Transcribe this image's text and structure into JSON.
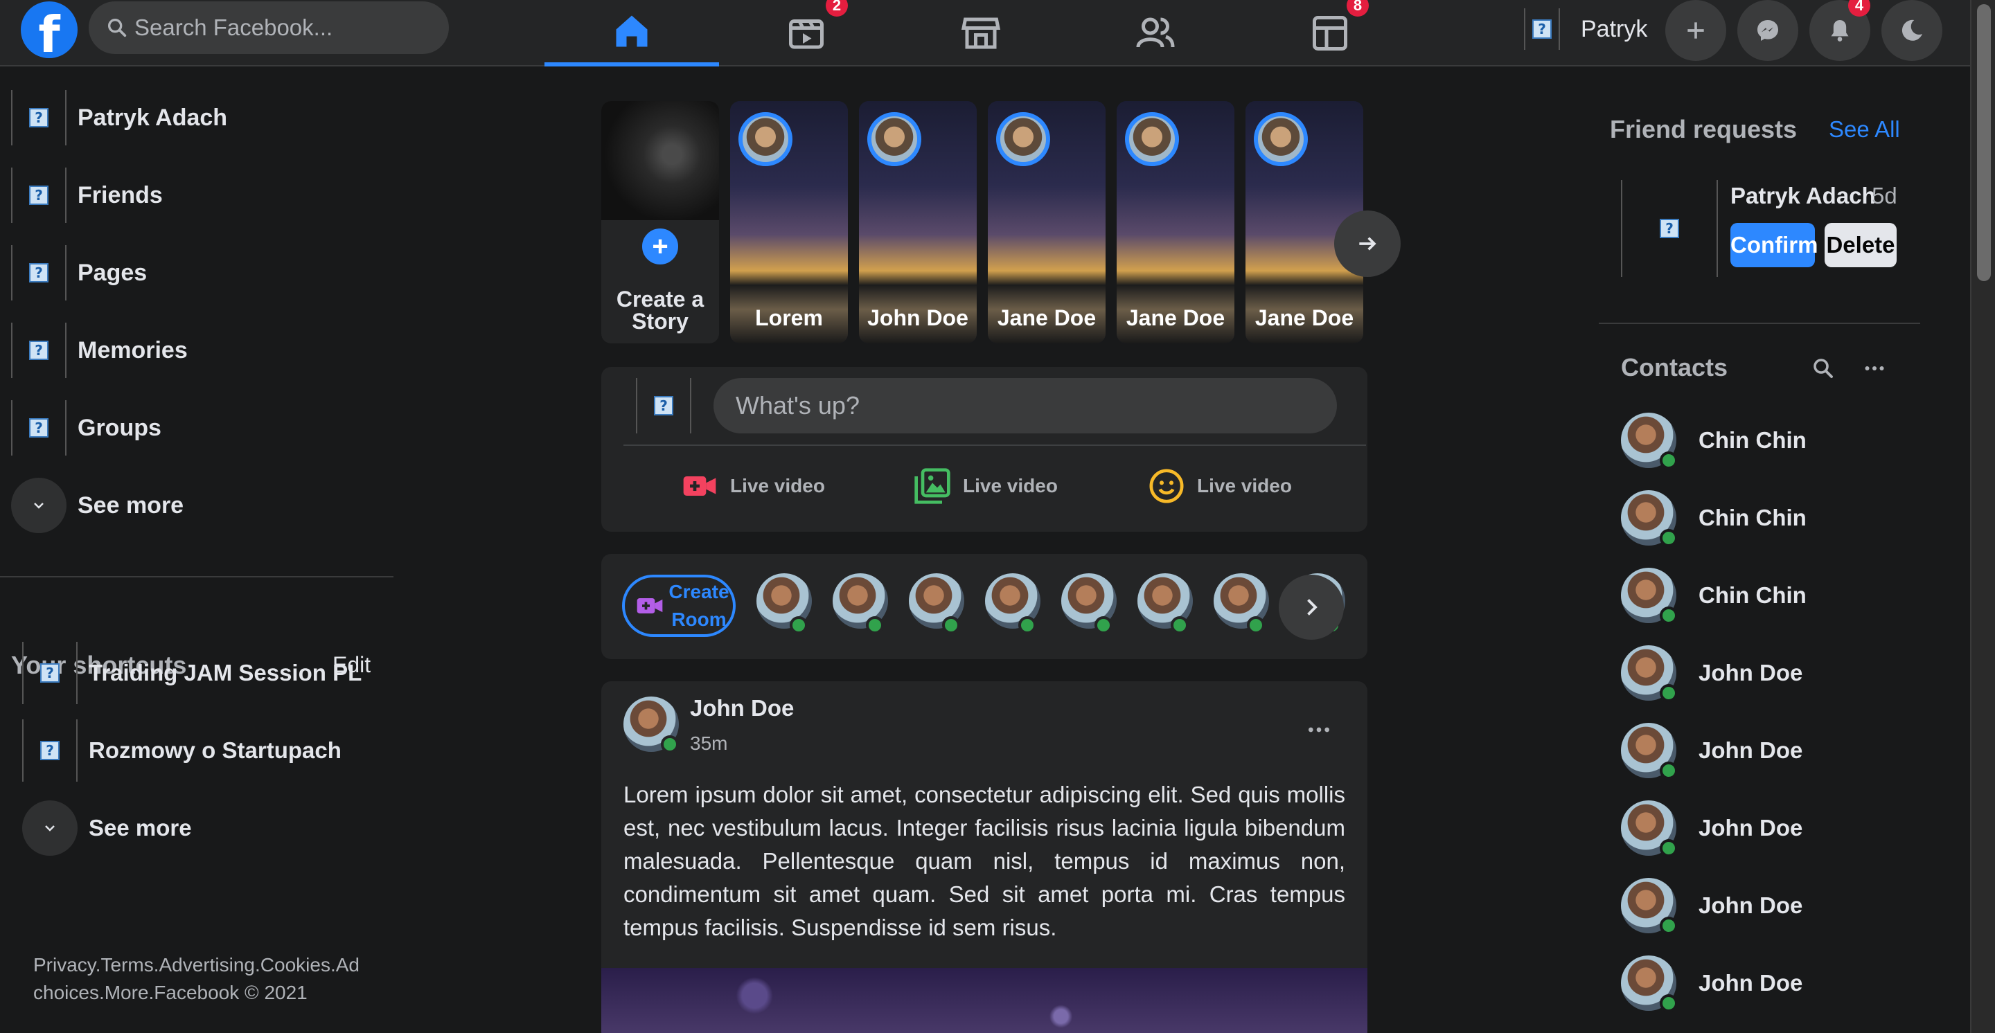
{
  "header": {
    "logo": "f",
    "search_placeholder": "Search Facebook...",
    "nav": [
      {
        "icon": "home-icon",
        "active": true,
        "badge": ""
      },
      {
        "icon": "watch-icon",
        "active": false,
        "badge": "2"
      },
      {
        "icon": "marketplace-icon",
        "active": false,
        "badge": ""
      },
      {
        "icon": "groups-icon",
        "active": false,
        "badge": ""
      },
      {
        "icon": "gaming-icon",
        "active": false,
        "badge": "8"
      }
    ],
    "profile_name": "Patryk",
    "notifications_badge": "4",
    "accent_color": "#2d88ff"
  },
  "sidebar": {
    "items": [
      {
        "label": "Patryk Adach"
      },
      {
        "label": "Friends"
      },
      {
        "label": "Pages"
      },
      {
        "label": "Memories"
      },
      {
        "label": "Groups"
      }
    ],
    "see_more": "See more",
    "shortcuts_title": "Your shortcuts",
    "shortcuts_edit": "Edit",
    "shortcuts": [
      {
        "label": "Traiding JAM Session PL"
      },
      {
        "label": "Rozmowy o Startupach"
      }
    ],
    "shortcuts_see_more": "See more",
    "footer": "Privacy.Terms.Advertising.Cookies.Ad choices.More.Facebook © 2021"
  },
  "stories": {
    "create_label": "Create a Story",
    "items": [
      {
        "name": "Lorem"
      },
      {
        "name": "John Doe"
      },
      {
        "name": "Jane Doe"
      },
      {
        "name": "Jane Doe"
      },
      {
        "name": "Jane Doe"
      }
    ]
  },
  "composer": {
    "placeholder": "What's up?",
    "actions": [
      {
        "label": "Live video",
        "icon": "video-camera-icon",
        "color": "#f3425f"
      },
      {
        "label": "Live video",
        "icon": "photo-icon",
        "color": "#45bd62"
      },
      {
        "label": "Live video",
        "icon": "smiley-icon",
        "color": "#f7b928"
      }
    ]
  },
  "rooms": {
    "create_label": "Create Room"
  },
  "post": {
    "author": "John Doe",
    "time": "35m",
    "text": "Lorem ipsum dolor sit amet, consectetur adipiscing elit. Sed quis mollis est, nec vestibulum lacus. Integer facilisis risus lacinia ligula bibendum malesuada. Pellentesque quam nisl, tempus id maximus non, condimentum sit amet quam. Sed sit amet porta mi. Cras tempus tempus facilisis. Suspendisse id sem risus."
  },
  "friend_requests": {
    "title": "Friend requests",
    "see_all": "See All",
    "name": "Patryk Adach",
    "time": "5d",
    "confirm": "Confirm",
    "delete": "Delete"
  },
  "contacts": {
    "title": "Contacts",
    "items": [
      {
        "name": "Chin Chin"
      },
      {
        "name": "Chin Chin"
      },
      {
        "name": "Chin Chin"
      },
      {
        "name": "John Doe"
      },
      {
        "name": "John Doe"
      },
      {
        "name": "John Doe"
      },
      {
        "name": "John Doe"
      },
      {
        "name": "John Doe"
      }
    ]
  }
}
